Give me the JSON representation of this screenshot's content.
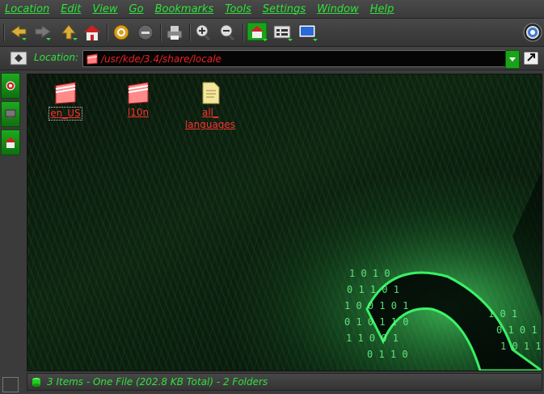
{
  "menubar": {
    "items": [
      "Location",
      "Edit",
      "View",
      "Go",
      "Bookmarks",
      "Tools",
      "Settings",
      "Window",
      "Help"
    ]
  },
  "toolbar": {
    "buttons": [
      "back-icon",
      "forward-icon",
      "up-icon",
      "home-icon",
      "reload-icon",
      "stop-icon",
      "print-icon",
      "zoom-in-icon",
      "zoom-out-icon",
      "icon-view-icon",
      "details-view-icon",
      "preview-icon",
      "kde-gear-icon"
    ]
  },
  "location": {
    "label": "Location:",
    "value": "/usr/kde/3.4/share/locale"
  },
  "files": [
    {
      "name": "en_US",
      "type": "folder",
      "selected": true
    },
    {
      "name": "l10n",
      "type": "folder",
      "selected": false
    },
    {
      "name": "all_\nlanguages",
      "type": "file",
      "selected": false
    }
  ],
  "status": {
    "text": "3 Items - One File (202.8 KB Total) - 2 Folders"
  },
  "colors": {
    "accent": "#2fe23a",
    "link": "#ff3030",
    "panel": "#3b3b3b"
  }
}
